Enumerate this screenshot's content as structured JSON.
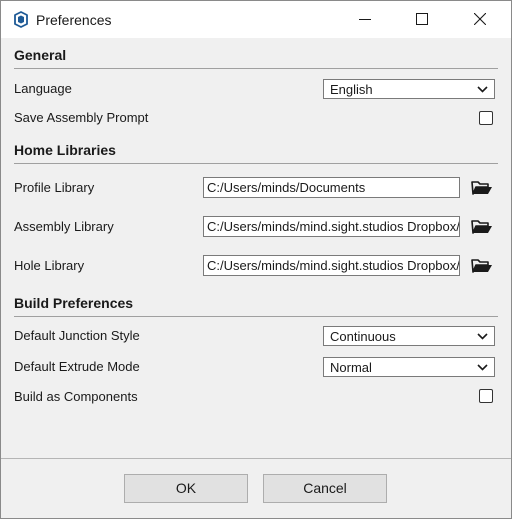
{
  "window": {
    "title": "Preferences",
    "icon": "sketchup-logo-icon",
    "controls": [
      "minimize-icon",
      "maximize-icon",
      "close-icon"
    ]
  },
  "general": {
    "heading": "General",
    "language_label": "Language",
    "language_value": "English",
    "save_assembly_prompt_label": "Save Assembly Prompt",
    "save_assembly_prompt_checked": false
  },
  "home_libraries": {
    "heading": "Home Libraries",
    "profile_label": "Profile Library",
    "profile_value": "C:/Users/minds/Documents",
    "assembly_label": "Assembly Library",
    "assembly_value": "C:/Users/minds/mind.sight.studios Dropbox/",
    "hole_label": "Hole Library",
    "hole_value": "C:/Users/minds/mind.sight.studios Dropbox/",
    "browse_icon": "folder-open-icon"
  },
  "build_preferences": {
    "heading": "Build Preferences",
    "junction_label": "Default Junction Style",
    "junction_value": "Continuous",
    "extrude_label": "Default Extrude Mode",
    "extrude_value": "Normal",
    "components_label": "Build as Components",
    "components_checked": false
  },
  "footer": {
    "ok_label": "OK",
    "cancel_label": "Cancel"
  }
}
